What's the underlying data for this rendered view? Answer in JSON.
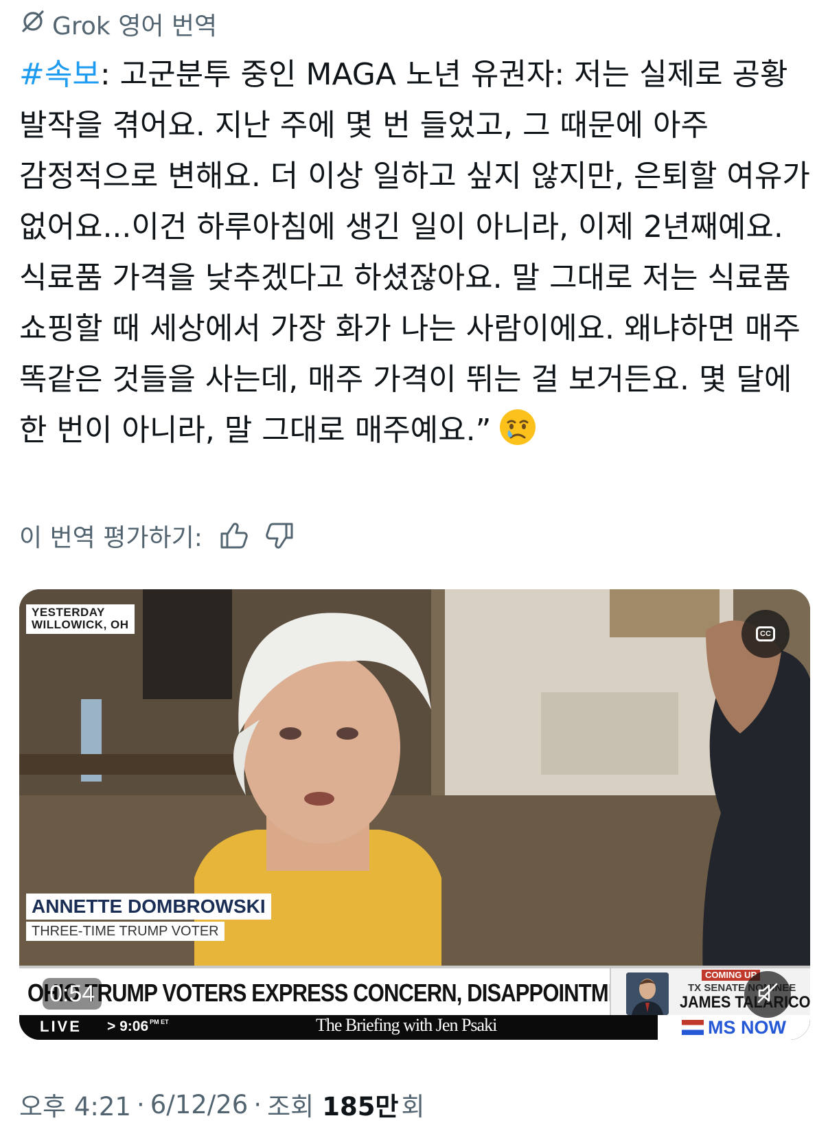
{
  "translation_header": {
    "label": "Grok 영어 번역",
    "icon": "grok-icon"
  },
  "post": {
    "hashtag": "#속보",
    "body": ": 고군분투 중인 MAGA 노년 유권자: 저는 실제로 공황 발작을 겪어요. 지난 주에 몇 번 들었고, 그 때문에 아주 감정적으로 변해요. 더 이상 일하고 싶지 않지만, 은퇴할 여유가 없어요...이건 하루아침에 생긴 일이 아니라, 이제 2년째예요. 식료품 가격을 낮추겠다고 하셨잖아요. 말 그대로 저는 식료품 쇼핑할 때 세상에서 가장 화가 나는 사람이에요. 왜냐하면 매주 똑같은 것들을 사는데, 매주 가격이 뛰는 걸 보거든요. 몇 달에 한 번이 아니라, 말 그대로 매주예요.”",
    "emoji": "crying-face-emoji"
  },
  "rating": {
    "label": "이 번역 평가하기:",
    "like_icon": "thumbs-up-icon",
    "dislike_icon": "thumbs-down-icon"
  },
  "video": {
    "location_line1": "YESTERDAY",
    "location_line2": "WILLOWICK, OH",
    "lower_third_name": "ANNETTE DOMBROWSKI",
    "lower_third_title": "THREE-TIME TRUMP VOTER",
    "headline": "OHIO TRUMP VOTERS EXPRESS CONCERN, DISAPPOINTMENT",
    "coming_up": "COMING UP",
    "coming_up_line": "TX SENATE NOMINEE",
    "coming_up_name": "JAMES TALARICO",
    "live": "LIVE",
    "clock": "> 9:06",
    "clock_suffix": "PM ET",
    "show_name": "The Briefing with Jen Psaki",
    "network": "MS NOW",
    "elapsed": "0:54",
    "cc_label": "CC",
    "accent_colors": {
      "network_blue": "#2458d6",
      "coming_up_red": "#c0392b"
    }
  },
  "meta": {
    "time": "오후 4:21",
    "sep1": "·",
    "date": "6/12/26",
    "sep2": "·",
    "views_prefix": "조회",
    "views_count": "185만",
    "views_suffix": "회"
  }
}
